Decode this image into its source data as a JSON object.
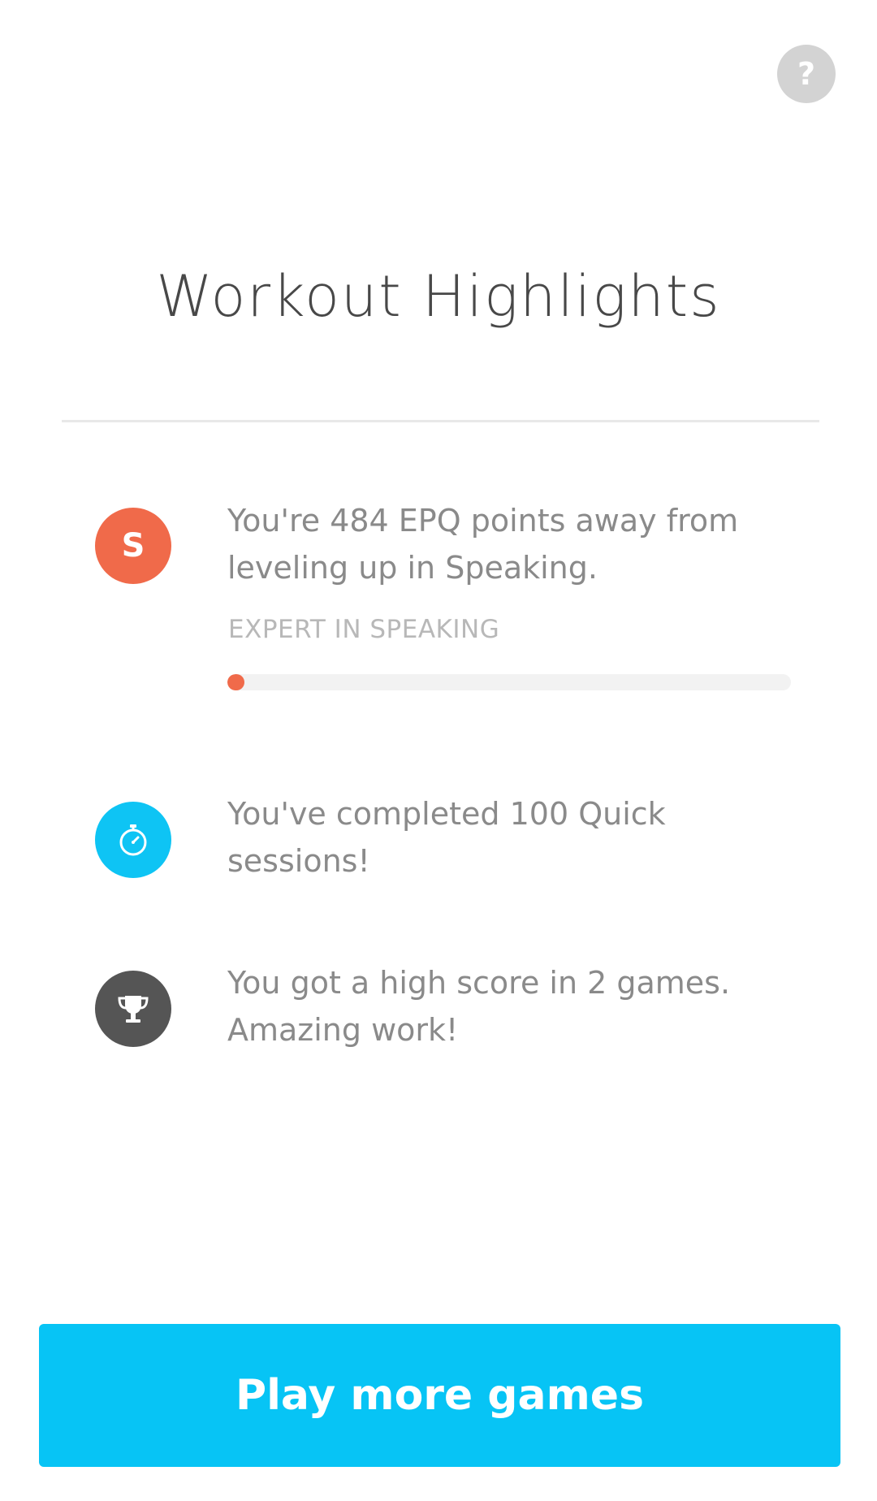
{
  "help": {
    "icon": "question-mark-icon",
    "glyph": "?"
  },
  "title": "Workout Highlights",
  "highlights": [
    {
      "icon": "speaking-letter-icon",
      "icon_letter": "S",
      "icon_color": "#f06a4a",
      "text": "You're 484 EPQ points away from leveling up in Speaking.",
      "skill_label": "EXPERT IN SPEAKING",
      "progress": 0.03,
      "progress_color": "#f06a4a"
    },
    {
      "icon": "stopwatch-icon",
      "icon_color": "#0ec4f4",
      "text": "You've completed 100 Quick sessions!"
    },
    {
      "icon": "trophy-icon",
      "icon_color": "#555555",
      "text": "You got a high score in 2 games. Amazing work!"
    }
  ],
  "cta": {
    "label": "Play more games",
    "color": "#07c4f5"
  }
}
